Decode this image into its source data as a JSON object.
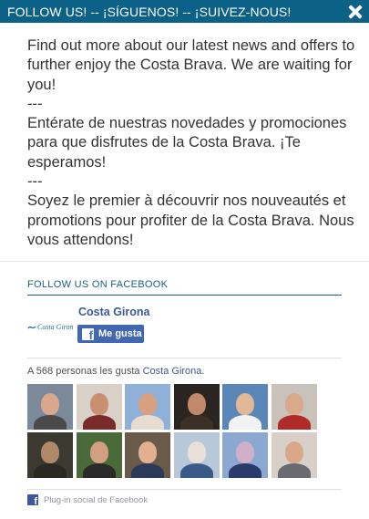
{
  "header": {
    "title": "FOLLOW US! -- ¡SÍGUENOS! -- ¡SUIVEZ-NOUS!",
    "close_icon": "close-icon",
    "background": "#0b6186"
  },
  "message": {
    "english": "Find out more about our latest news and offers to further enjoy the Costa Brava. We are waiting for you!",
    "separator_1": "---",
    "spanish": "Entérate de nuestras novedades y promociones para que disfrutes de la Costa Brava. ¡Te esperamos!",
    "separator_2": "---",
    "french": "Soyez le premier à découvrir nos nouveautés et promotions pour profiter de la Costa Brava. Nous vous attendons!"
  },
  "facebook": {
    "section_title": "FOLLOW US ON FACEBOOK",
    "page_name": "Costa Girona",
    "logo_text": "Costa Girona",
    "like_button": "Me gusta",
    "likes_prefix": "A 568 personas les gusta ",
    "likes_page": "Costa Girona",
    "likes_suffix": ".",
    "plugin_label": "Plug-in social de Facebook",
    "fb_blue": "#3b5998",
    "faces": [
      {
        "bg": "#7a8a9a",
        "skin": "#d9a88a",
        "cloth": "#4a4a4a"
      },
      {
        "bg": "#d9d0c8",
        "skin": "#c98f70",
        "cloth": "#7a2a2a"
      },
      {
        "bg": "#8fb0d8",
        "skin": "#d8a080",
        "cloth": "#e6dcd0"
      },
      {
        "bg": "#2a2520",
        "skin": "#c08a6a",
        "cloth": "#3a3028"
      },
      {
        "bg": "#5a87b8",
        "skin": "#e0b898",
        "cloth": "#f2f2f2"
      },
      {
        "bg": "#c9c2ba",
        "skin": "#d8a98a",
        "cloth": "#b02a2a"
      },
      {
        "bg": "#3a3a30",
        "skin": "#b08868",
        "cloth": "#2a2a22"
      },
      {
        "bg": "#4a6a3a",
        "skin": "#d0a080",
        "cloth": "#2a2a2a"
      },
      {
        "bg": "#6a5a4a",
        "skin": "#e0b090",
        "cloth": "#2a3a5a"
      },
      {
        "bg": "#b8c8d8",
        "skin": "#e8e0d8",
        "cloth": "#3a5a8a"
      },
      {
        "bg": "#8aa8d0",
        "skin": "#d0b0c8",
        "cloth": "#2a3a6a"
      },
      {
        "bg": "#d8d0c8",
        "skin": "#d8a888",
        "cloth": "#6a6a70"
      }
    ]
  }
}
